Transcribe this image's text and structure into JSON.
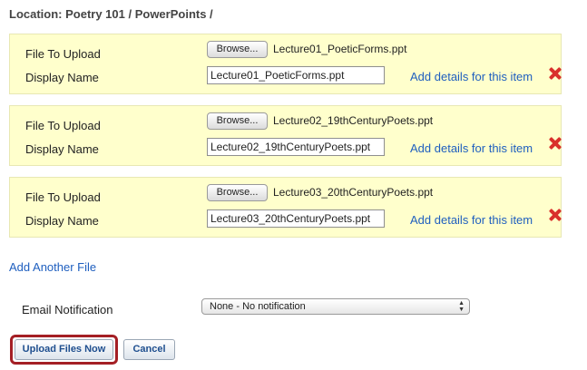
{
  "location": {
    "text": "Location: Poetry 101 / PowerPoints /"
  },
  "files": [
    {
      "upload_label": "File To Upload",
      "browse_label": "Browse...",
      "file_name": "Lecture01_PoeticForms.ppt",
      "display_label": "Display Name",
      "display_value": "Lecture01_PoeticForms.ppt",
      "details_link": "Add details for this item"
    },
    {
      "upload_label": "File To Upload",
      "browse_label": "Browse...",
      "file_name": "Lecture02_19thCenturyPoets.ppt",
      "display_label": "Display Name",
      "display_value": "Lecture02_19thCenturyPoets.ppt",
      "details_link": "Add details for this item"
    },
    {
      "upload_label": "File To Upload",
      "browse_label": "Browse...",
      "file_name": "Lecture03_20thCenturyPoets.ppt",
      "display_label": "Display Name",
      "display_value": "Lecture03_20thCenturyPoets.ppt",
      "details_link": "Add details for this item"
    }
  ],
  "add_another": "Add Another File",
  "email": {
    "label": "Email Notification",
    "selected": "None - No notification"
  },
  "buttons": {
    "upload": "Upload Files Now",
    "cancel": "Cancel"
  },
  "colors": {
    "block_bg": "#ffffcc",
    "link": "#1f5fbf",
    "remove": "#d9302c",
    "highlight": "#a41f25"
  },
  "icons": {
    "remove": "remove-x-icon",
    "select_arrows": "updown-arrows-icon"
  }
}
